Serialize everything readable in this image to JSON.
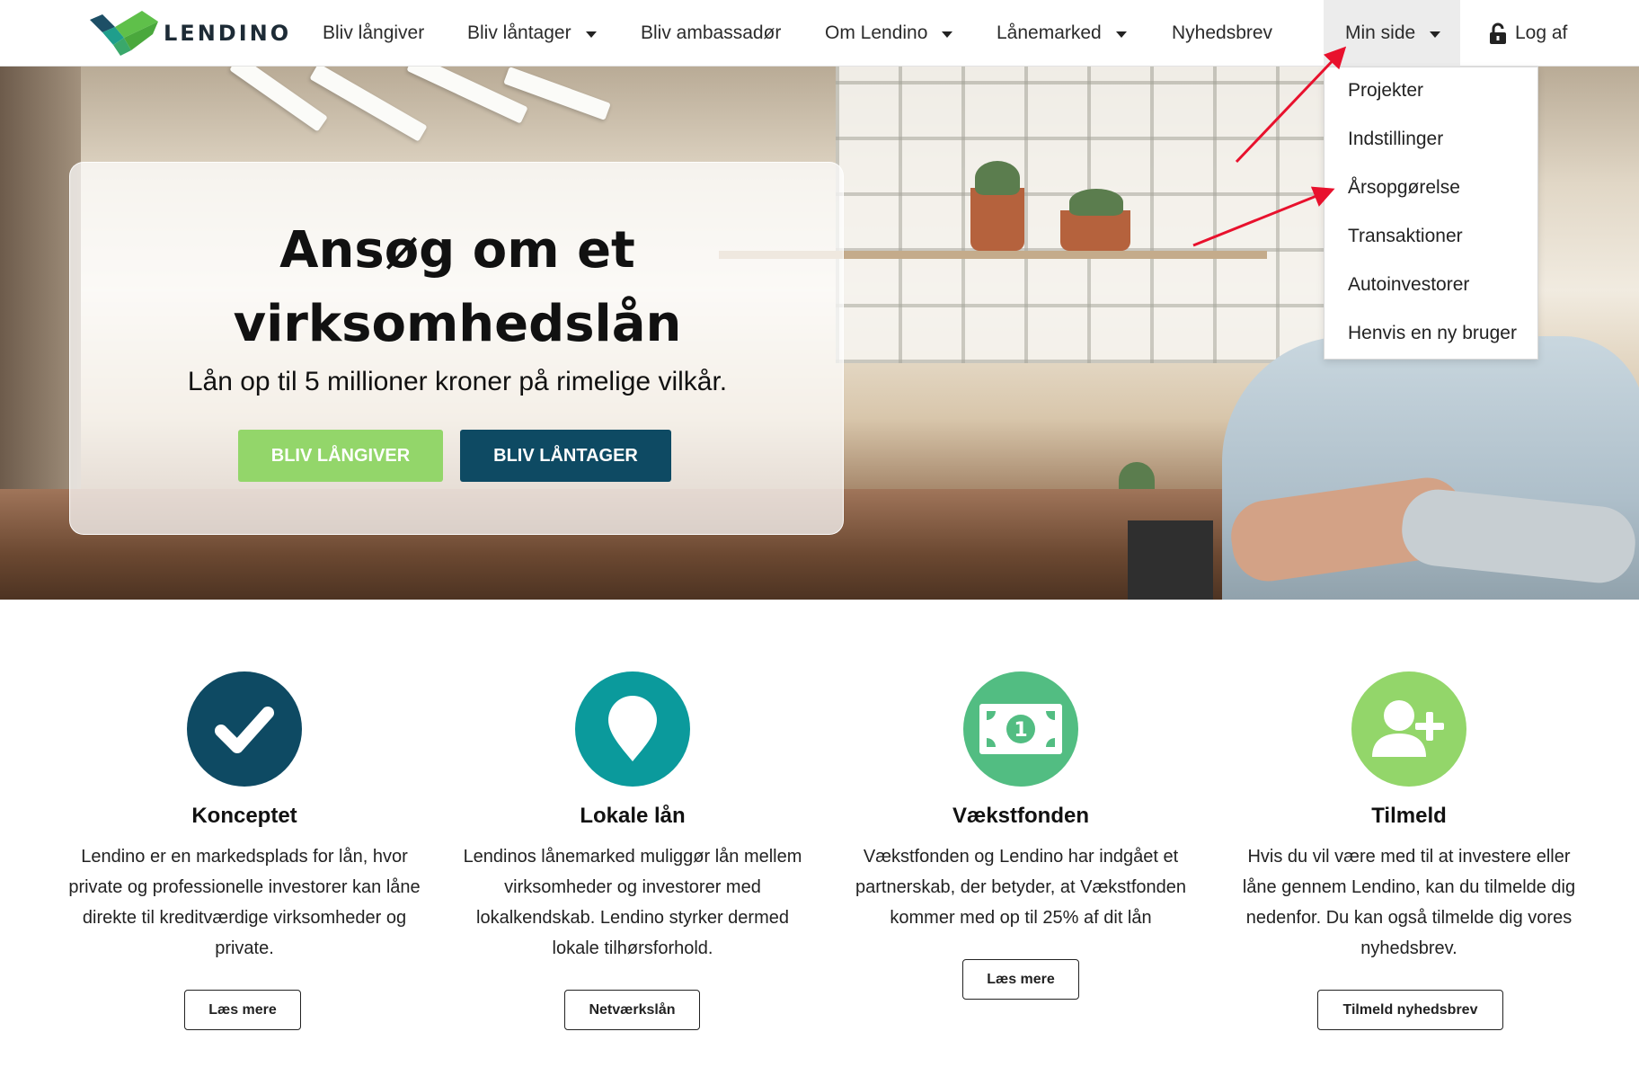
{
  "brand": {
    "name": "LENDINO"
  },
  "nav": {
    "items": [
      {
        "label": "Bliv långiver"
      },
      {
        "label": "Bliv låntager"
      },
      {
        "label": "Bliv ambassadør"
      },
      {
        "label": "Om Lendino"
      },
      {
        "label": "Lånemarked"
      },
      {
        "label": "Nyhedsbrev"
      },
      {
        "label": "Min side"
      },
      {
        "label": "Log af"
      }
    ]
  },
  "dropdown": {
    "items": [
      "Projekter",
      "Indstillinger",
      "Årsopgørelse",
      "Transaktioner",
      "Autoinvestorer",
      "Henvis en ny bruger"
    ]
  },
  "hero": {
    "title_line1": "Ansøg om et",
    "title_line2": "virksomhedslån",
    "subtitle": "Lån op til 5 millioner kroner på rimelige vilkår.",
    "btn_lender": "BLIV LÅNGIVER",
    "btn_borrower": "BLIV LÅNTAGER"
  },
  "features": [
    {
      "title": "Konceptet",
      "text": "Lendino er en markedsplads for lån, hvor private og professionelle investorer kan låne direkte til kreditværdige virksomheder og private.",
      "button": "Læs mere",
      "icon": "checkmark-icon",
      "color": "#0e4a63"
    },
    {
      "title": "Lokale lån",
      "text": "Lendinos lånemarked muliggør lån mellem virksomheder og investorer med lokalkendskab. Lendino styrker dermed lokale tilhørsforhold.",
      "button": "Netværkslån",
      "icon": "map-pin-icon",
      "color": "#0b9a9c"
    },
    {
      "title": "Vækstfonden",
      "text": "Vækstfonden og Lendino har indgået et partnerskab, der betyder, at Vækstfonden kommer med op til 25% af dit lån",
      "button": "Læs mere",
      "icon": "banknote-icon",
      "color": "#52bd82"
    },
    {
      "title": "Tilmeld",
      "text": "Hvis du vil være med til at investere eller låne gennem Lendino, kan du tilmelde dig nedenfor. Du kan også tilmelde dig vores nyhedsbrev.",
      "button": "Tilmeld nyhedsbrev",
      "icon": "add-user-icon",
      "color": "#93d66a"
    }
  ]
}
